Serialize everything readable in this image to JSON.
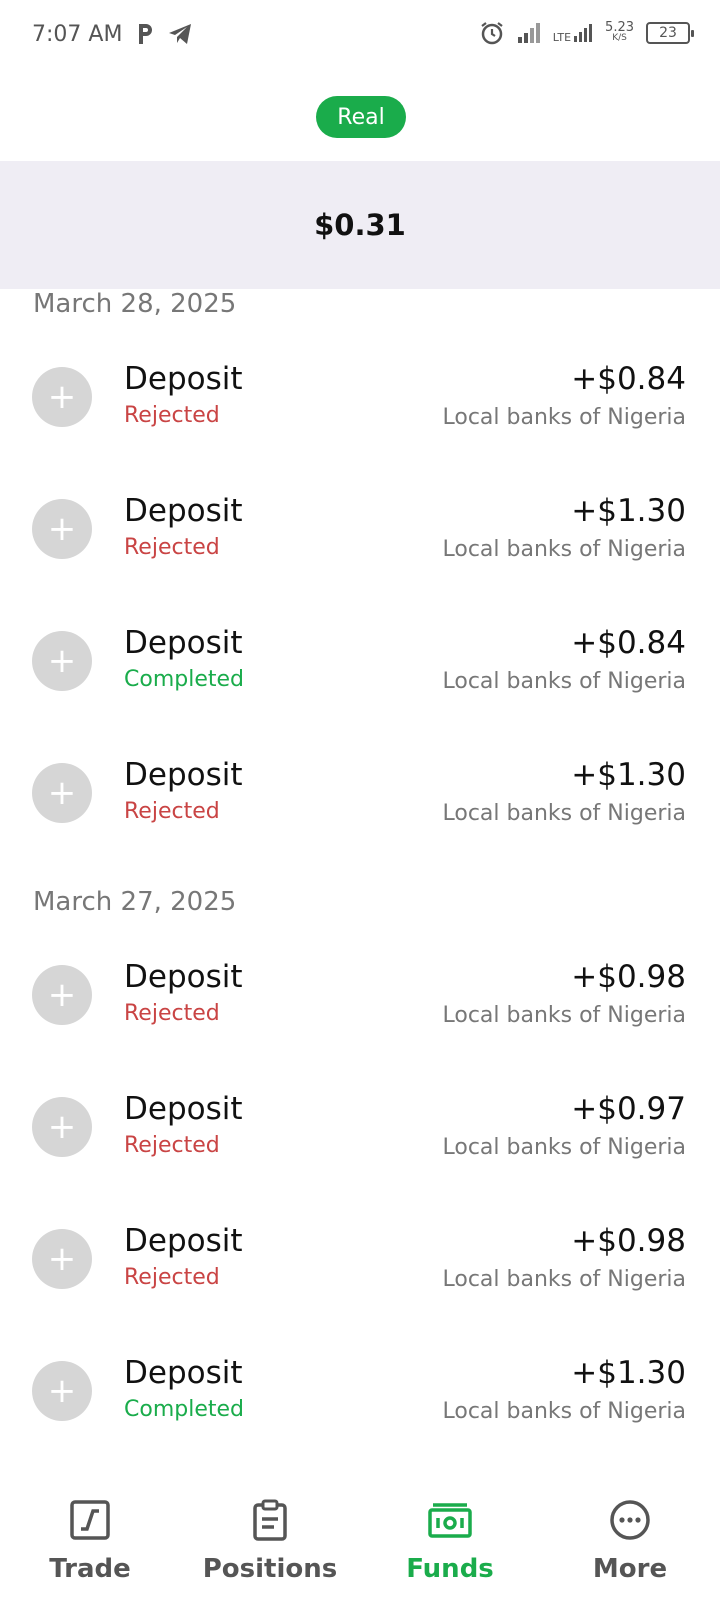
{
  "status_bar": {
    "time": "7:07 AM",
    "net_type": "LTE",
    "speed_value": "5.23",
    "speed_unit": "K/S",
    "battery": "23",
    "icons": [
      "p-icon",
      "telegram-icon",
      "alarm-icon",
      "signal-icon",
      "lte-signal-icon",
      "battery-icon"
    ]
  },
  "account": {
    "type_label": "Real",
    "accent_color": "#1aac4b"
  },
  "balance": {
    "value": "$0.31"
  },
  "groups": [
    {
      "date": "March 28, 2025",
      "transactions": [
        {
          "title": "Deposit",
          "status": "Rejected",
          "status_kind": "rejected",
          "amount": "+$0.84",
          "method": "Local banks of Nigeria"
        },
        {
          "title": "Deposit",
          "status": "Rejected",
          "status_kind": "rejected",
          "amount": "+$1.30",
          "method": "Local banks of Nigeria"
        },
        {
          "title": "Deposit",
          "status": "Completed",
          "status_kind": "completed",
          "amount": "+$0.84",
          "method": "Local banks of Nigeria"
        },
        {
          "title": "Deposit",
          "status": "Rejected",
          "status_kind": "rejected",
          "amount": "+$1.30",
          "method": "Local banks of Nigeria"
        }
      ]
    },
    {
      "date": "March 27, 2025",
      "transactions": [
        {
          "title": "Deposit",
          "status": "Rejected",
          "status_kind": "rejected",
          "amount": "+$0.98",
          "method": "Local banks of Nigeria"
        },
        {
          "title": "Deposit",
          "status": "Rejected",
          "status_kind": "rejected",
          "amount": "+$0.97",
          "method": "Local banks of Nigeria"
        },
        {
          "title": "Deposit",
          "status": "Rejected",
          "status_kind": "rejected",
          "amount": "+$0.98",
          "method": "Local banks of Nigeria"
        },
        {
          "title": "Deposit",
          "status": "Completed",
          "status_kind": "completed",
          "amount": "+$1.30",
          "method": "Local banks of Nigeria"
        }
      ]
    }
  ],
  "tx_icon_glyph": "+",
  "nav": {
    "items": [
      {
        "label": "Trade",
        "icon": "trade-chart-icon",
        "active": false
      },
      {
        "label": "Positions",
        "icon": "clipboard-icon",
        "active": false
      },
      {
        "label": "Funds",
        "icon": "banknote-icon",
        "active": true
      },
      {
        "label": "More",
        "icon": "more-dots-icon",
        "active": false
      }
    ]
  }
}
